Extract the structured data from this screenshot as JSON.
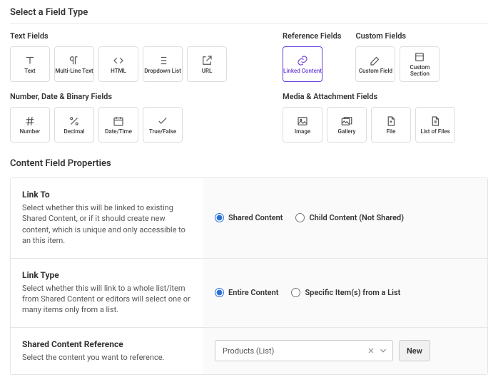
{
  "page_title": "Select a Field Type",
  "groups": {
    "text": {
      "title": "Text Fields",
      "items": [
        {
          "key": "text",
          "label": "Text"
        },
        {
          "key": "multiline",
          "label": "Multi-Line Text"
        },
        {
          "key": "html",
          "label": "HTML"
        },
        {
          "key": "dropdown",
          "label": "Dropdown List"
        },
        {
          "key": "url",
          "label": "URL"
        }
      ]
    },
    "reference": {
      "title": "Reference Fields",
      "items": [
        {
          "key": "linked",
          "label": "Linked Content",
          "selected": true
        }
      ]
    },
    "custom": {
      "title": "Custom Fields",
      "items": [
        {
          "key": "customfield",
          "label": "Custom Field"
        },
        {
          "key": "customsection",
          "label": "Custom Section"
        }
      ]
    },
    "numdate": {
      "title": "Number, Date & Binary Fields",
      "items": [
        {
          "key": "number",
          "label": "Number"
        },
        {
          "key": "decimal",
          "label": "Decimal"
        },
        {
          "key": "datetime",
          "label": "Date/Time"
        },
        {
          "key": "boolean",
          "label": "True/False"
        }
      ]
    },
    "media": {
      "title": "Media & Attachment Fields",
      "items": [
        {
          "key": "image",
          "label": "Image"
        },
        {
          "key": "gallery",
          "label": "Gallery"
        },
        {
          "key": "file",
          "label": "File"
        },
        {
          "key": "filelist",
          "label": "List of Files"
        }
      ]
    }
  },
  "properties": {
    "title": "Content Field Properties",
    "link_to": {
      "label": "Link To",
      "desc": "Select whether this will be linked to existing Shared Content, or if it should create new content, which is unique and only accessible to an this item.",
      "options": [
        {
          "label": "Shared Content",
          "checked": true
        },
        {
          "label": "Child Content (Not Shared)",
          "checked": false
        }
      ]
    },
    "link_type": {
      "label": "Link Type",
      "desc": "Select whether this will link to a whole list/item from Shared Content or editors will select one or many items only from a list.",
      "options": [
        {
          "label": "Entire Content",
          "checked": true
        },
        {
          "label": "Specific Item(s) from a List",
          "checked": false
        }
      ]
    },
    "reference": {
      "label": "Shared Content Reference",
      "desc": "Select the content you want to reference.",
      "selected_value": "Products (List)",
      "new_button": "New"
    }
  }
}
